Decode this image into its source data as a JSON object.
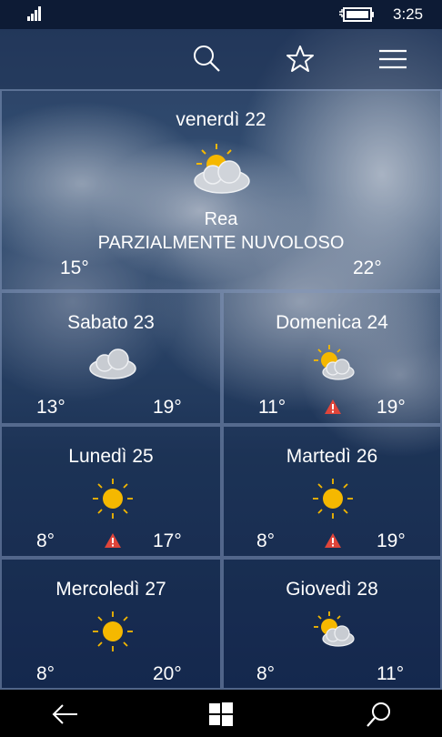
{
  "status_bar": {
    "time": "3:25",
    "icons": [
      "signal-icon",
      "battery-charging-icon"
    ]
  },
  "app_bar": {
    "icons": [
      "search-icon",
      "star-icon",
      "menu-icon"
    ]
  },
  "today": {
    "day": "venerdì 22",
    "icon": "partly-cloudy-icon",
    "location": "Rea",
    "condition": "PARZIALMENTE NUVOLOSO",
    "low": "15°",
    "high": "22°"
  },
  "forecast": [
    {
      "day": "Sabato 23",
      "icon": "cloudy-icon",
      "low": "13°",
      "high": "19°",
      "warning": false
    },
    {
      "day": "Domenica 24",
      "icon": "partly-cloudy-icon",
      "low": "11°",
      "high": "19°",
      "warning": true
    },
    {
      "day": "Lunedì 25",
      "icon": "sun-icon",
      "low": "8°",
      "high": "17°",
      "warning": true
    },
    {
      "day": "Martedì 26",
      "icon": "sun-icon",
      "low": "8°",
      "high": "19°",
      "warning": true
    },
    {
      "day": "Mercoledì 27",
      "icon": "sun-icon",
      "low": "8°",
      "high": "20°",
      "warning": false
    },
    {
      "day": "Giovedì 28",
      "icon": "partly-cloudy-icon",
      "low": "8°",
      "high": "11°",
      "warning": false
    }
  ],
  "colors": {
    "warning": "#e0453a",
    "sun": "#f5b800",
    "tile_border": "#8296b9"
  },
  "nav_bar": {
    "icons": [
      "back-icon",
      "windows-icon",
      "search-icon"
    ]
  }
}
